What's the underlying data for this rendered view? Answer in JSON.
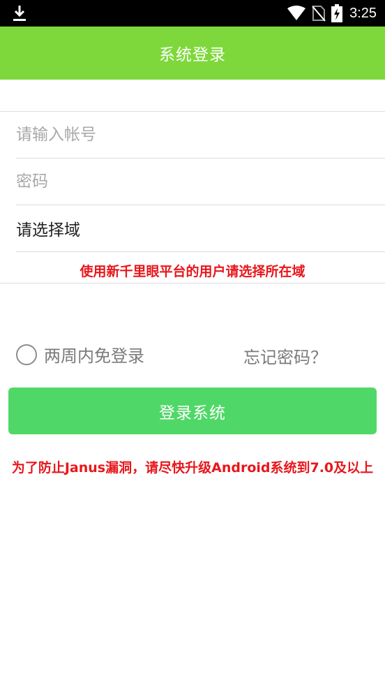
{
  "status_bar": {
    "time": "3:25",
    "icons": [
      "download-icon",
      "wifi-icon",
      "no-sim-icon",
      "battery-charging-icon"
    ]
  },
  "app_bar": {
    "title": "系统登录",
    "color": "#7ed83b"
  },
  "form": {
    "account_placeholder": "请输入帐号",
    "password_placeholder": "密码",
    "domain_value": "请选择域",
    "domain_hint": "使用新千里眼平台的用户请选择所在域"
  },
  "options": {
    "remember_label": "两周内免登录",
    "remember_checked": false,
    "forgot_label": "忘记密码？"
  },
  "login_button": {
    "label": "登录系统",
    "color": "#4fd867"
  },
  "warning": {
    "text": "为了防止Janus漏洞，请尽快升级Android系统到7.0及以上",
    "color": "#e8161b"
  }
}
